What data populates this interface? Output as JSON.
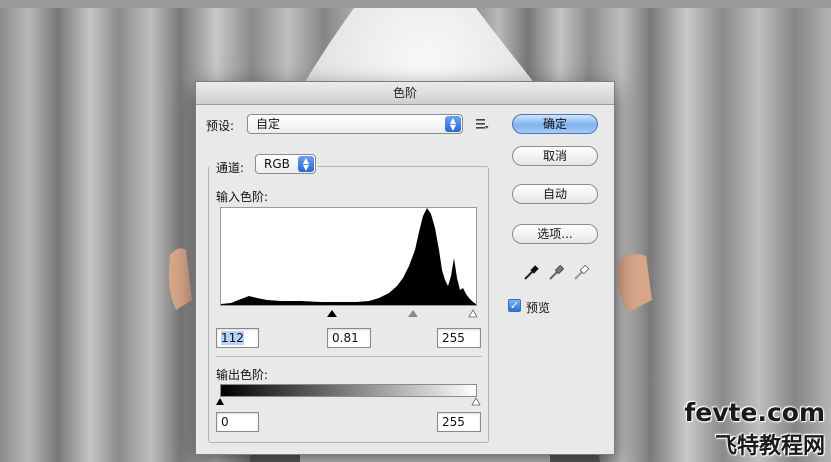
{
  "dialog": {
    "title": "色阶",
    "preset": {
      "label": "预设:",
      "value": "自定"
    },
    "channel": {
      "label": "通道:",
      "value": "RGB"
    },
    "input_levels": {
      "label": "输入色阶:",
      "black": "112",
      "gamma": "0.81",
      "white": "255"
    },
    "output_levels": {
      "label": "输出色阶:",
      "black": "0",
      "white": "255"
    },
    "buttons": {
      "ok": "确定",
      "cancel": "取消",
      "auto": "自动",
      "options": "选项..."
    },
    "preview": {
      "label": "预览",
      "checked": true
    },
    "colors": {
      "accent": "#2f6fd6",
      "dialog_bg": "#e9e9e9"
    }
  },
  "watermark": {
    "line1": "fevte.com",
    "line2": "飞特教程网"
  }
}
